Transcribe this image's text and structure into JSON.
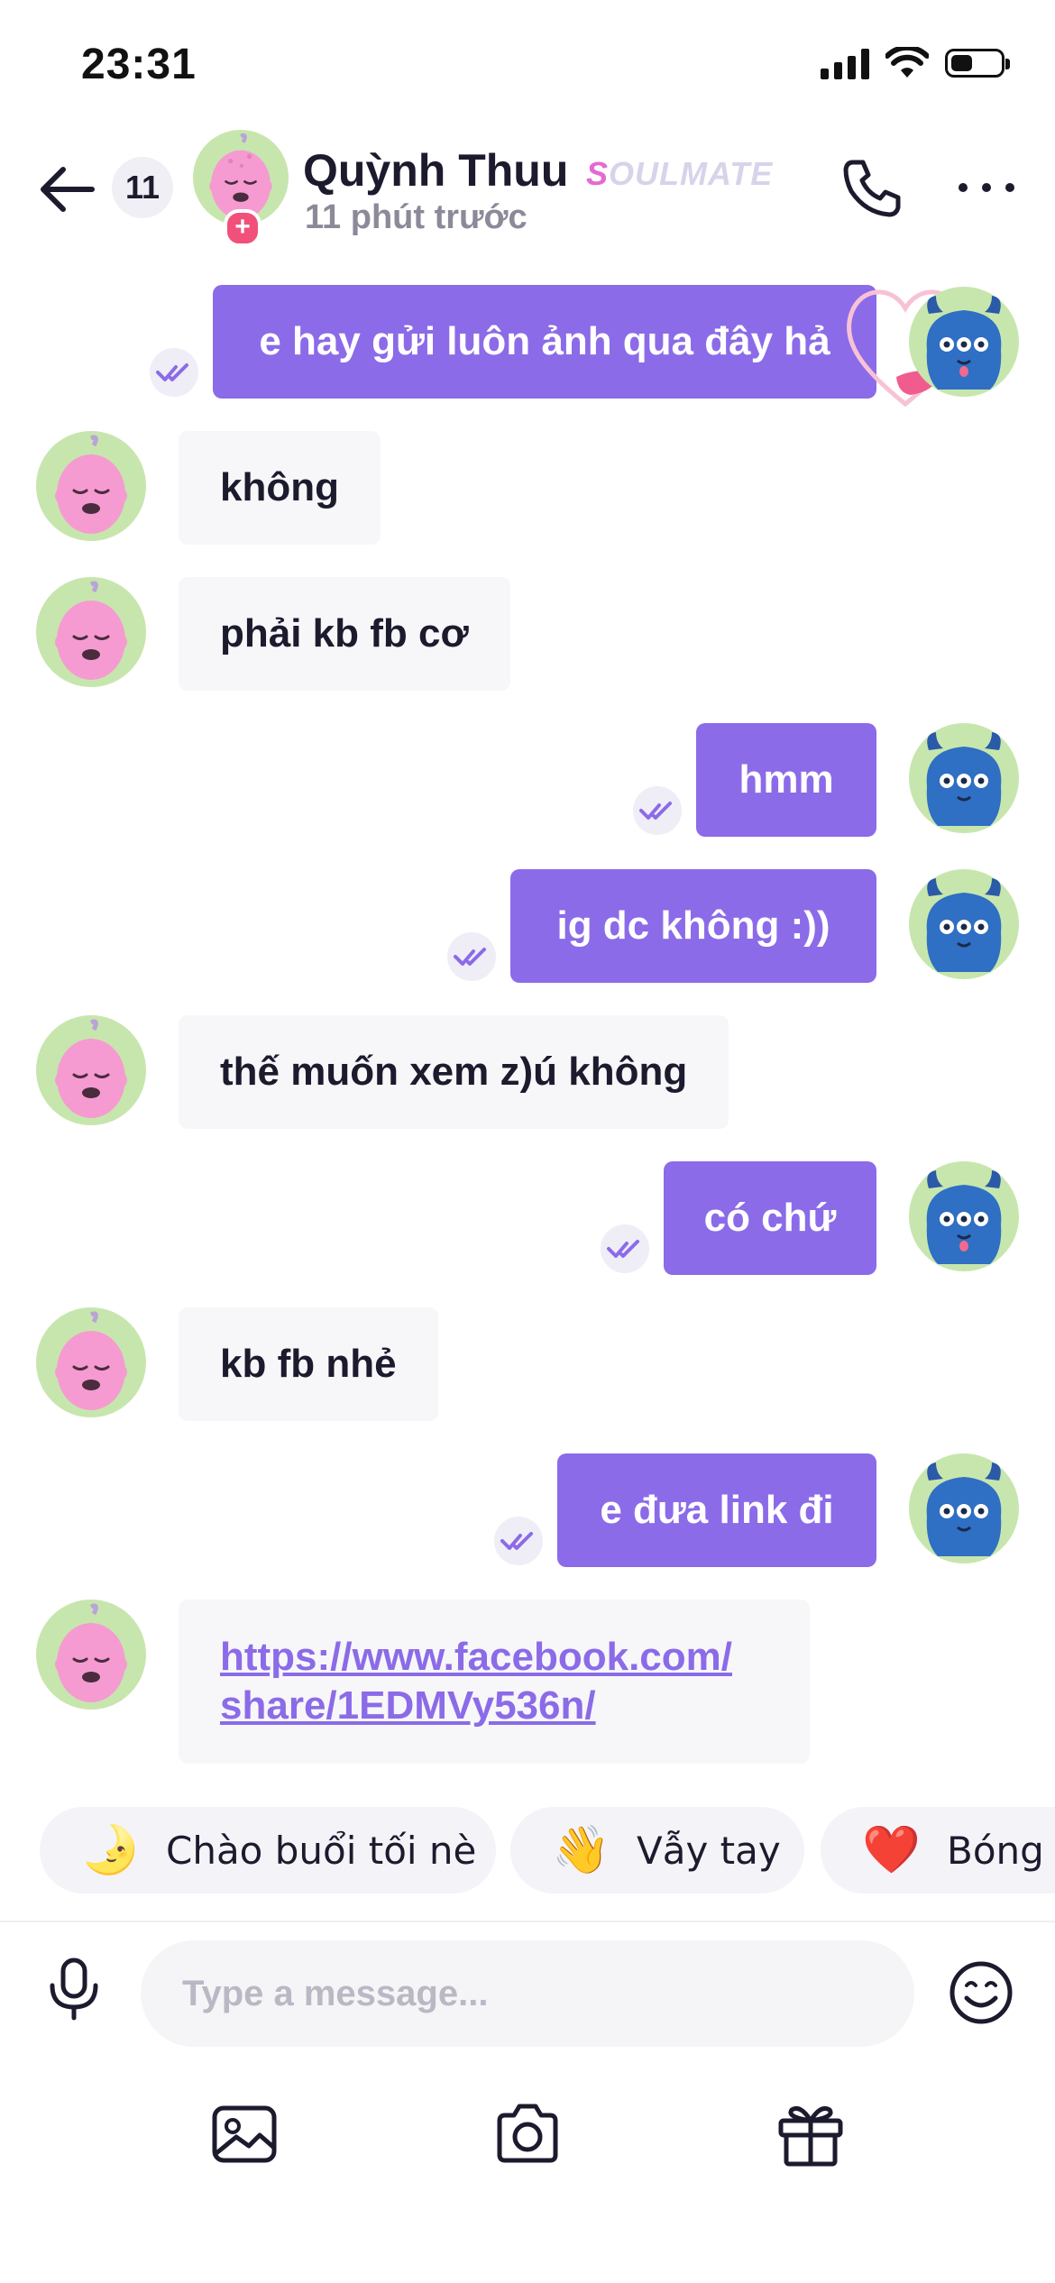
{
  "status_bar": {
    "time": "23:31",
    "battery_level": 0.45
  },
  "header": {
    "unread_count": "11",
    "contact_name": "Quỳnh Thuu",
    "tag_first_letter": "S",
    "tag_rest": "OULMATE",
    "last_seen": "11 phút trước"
  },
  "messages": [
    {
      "direction": "out",
      "text": "e hay gửi luôn ảnh qua đây hả",
      "status": "read"
    },
    {
      "direction": "in",
      "text": "không"
    },
    {
      "direction": "in",
      "text": "phải kb fb cơ"
    },
    {
      "direction": "out",
      "text": "hmm",
      "status": "read"
    },
    {
      "direction": "out",
      "text": "ig dc không :))",
      "status": "read"
    },
    {
      "direction": "in",
      "text": "thế muốn xem z)ú không"
    },
    {
      "direction": "out",
      "text": "có chứ",
      "status": "read"
    },
    {
      "direction": "in",
      "text": "kb fb nhẻ"
    },
    {
      "direction": "out",
      "text": "e đưa link đi",
      "status": "read"
    },
    {
      "direction": "in",
      "link_lines": [
        "https://www.facebook.com/",
        "share/1EDMVy536n/"
      ]
    }
  ],
  "quick_replies": [
    {
      "emoji": "🌛",
      "label": "Chào buổi tối nè"
    },
    {
      "emoji": "👋",
      "label": "Vẫy tay"
    },
    {
      "emoji": "❤️",
      "label": "Bóng b"
    }
  ],
  "composer": {
    "placeholder": "Type a message..."
  },
  "toolbar": {
    "icons": [
      "image-icon",
      "camera-icon",
      "gift-icon"
    ]
  },
  "colors": {
    "accent": "#8b6be8",
    "incoming_bubble": "#f7f7f9",
    "badge_pink": "#f0507a"
  }
}
